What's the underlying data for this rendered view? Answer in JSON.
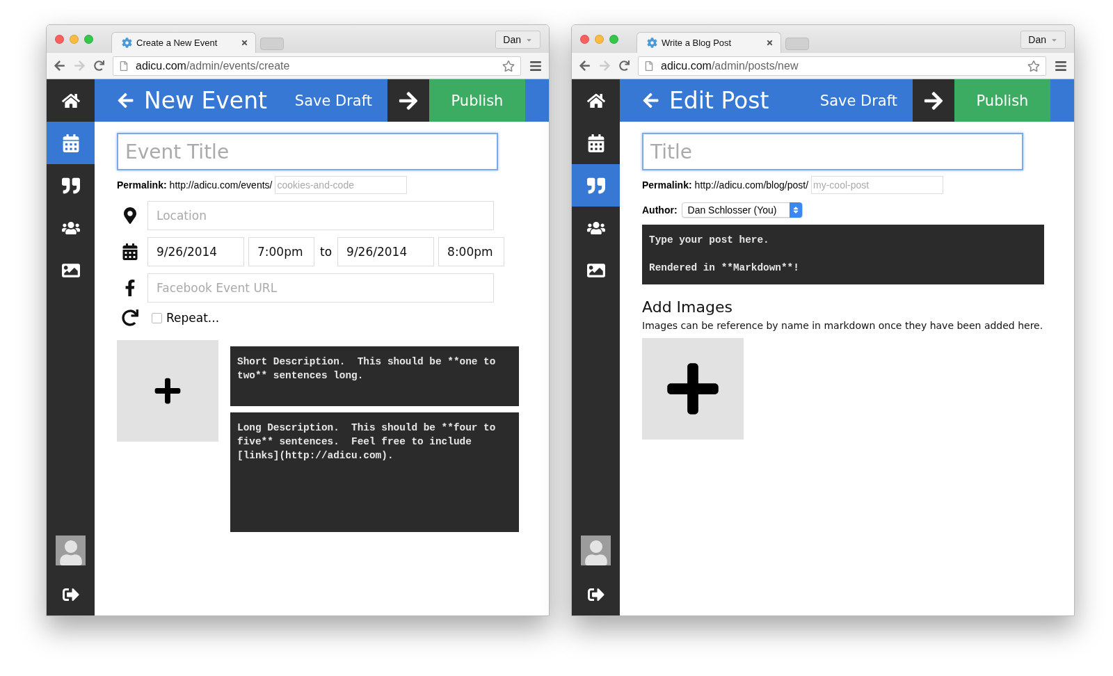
{
  "windows": [
    {
      "tab": {
        "title": "Create a New Event"
      },
      "profile": "Dan",
      "address": {
        "host": "adicu.com",
        "path": "/admin/events/create"
      },
      "nav": [
        {
          "kind": "calendar",
          "selected": true
        },
        {
          "kind": "quote",
          "selected": false
        },
        {
          "kind": "users",
          "selected": false
        },
        {
          "kind": "image",
          "selected": false
        }
      ],
      "header": {
        "title": "New Event",
        "save_draft": "Save Draft",
        "publish": "Publish"
      },
      "form": {
        "kind": "event",
        "title_placeholder": "Event Title",
        "permalink": {
          "label": "Permalink:",
          "base": "http://adicu.com/events/",
          "slug_placeholder": "cookies-and-code"
        },
        "location_placeholder": "Location",
        "start_date": "9/26/2014",
        "start_time": "7:00pm",
        "to": "to",
        "end_date": "9/26/2014",
        "end_time": "8:00pm",
        "facebook_placeholder": "Facebook Event URL",
        "repeat": {
          "label": "Repeat...",
          "checked": false
        },
        "short_description_placeholder": "Short Description.  This should be **one to two** sentences long.",
        "long_description_placeholder": "Long Description.  This should be **four to five** sentences.  Feel free to include [links](http://adicu.com)."
      }
    },
    {
      "tab": {
        "title": "Write a Blog Post"
      },
      "profile": "Dan",
      "address": {
        "host": "adicu.com",
        "path": "/admin/posts/new"
      },
      "nav": [
        {
          "kind": "calendar",
          "selected": false
        },
        {
          "kind": "quote",
          "selected": true
        },
        {
          "kind": "users",
          "selected": false
        },
        {
          "kind": "image",
          "selected": false
        }
      ],
      "header": {
        "title": "Edit Post",
        "save_draft": "Save Draft",
        "publish": "Publish"
      },
      "form": {
        "kind": "post",
        "title_placeholder": "Title",
        "permalink": {
          "label": "Permalink:",
          "base": "http://adicu.com/blog/post/",
          "slug_placeholder": "my-cool-post"
        },
        "author": {
          "label": "Author:",
          "value": "Dan Schlosser (You)"
        },
        "body_placeholder": "Type your post here.\n\nRendered in **Markdown**!",
        "images_heading": "Add Images",
        "images_help": "Images can be reference by name in markdown once they have been added here."
      }
    }
  ]
}
